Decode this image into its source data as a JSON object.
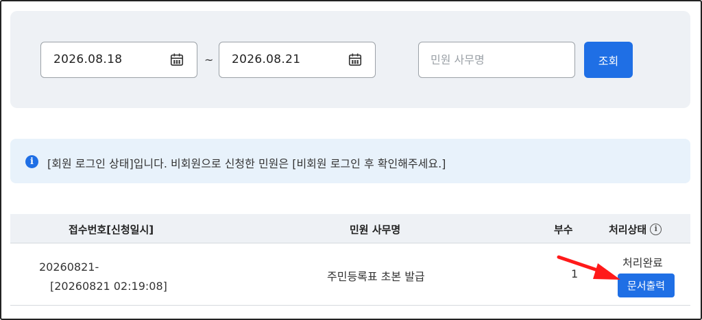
{
  "search": {
    "start_date": "2026.08.18",
    "end_date": "2026.08.21",
    "separator": "~",
    "service_placeholder": "민원 사무명",
    "search_button": "조회",
    "calendar_icon": "calendar-icon"
  },
  "notice": {
    "icon": "info-icon",
    "text": "[회원 로그인 상태]입니다. 비회원으로 신청한 민원은 [비회원 로그인 후 확인해주세요.]"
  },
  "table": {
    "headers": {
      "receipt": "접수번호[신청일시]",
      "service": "민원 사무명",
      "copies": "부수",
      "status": "처리상태"
    },
    "rows": [
      {
        "receipt_no": "20260821-",
        "applied_at": "[20260821 02:19:08]",
        "service": "주민등록표 초본 발급",
        "copies": "1",
        "status": "처리완료",
        "print_button": "문서출력"
      }
    ]
  },
  "colors": {
    "accent": "#1f6fe5",
    "panel_bg": "#eef1f5",
    "notice_bg": "#e8f2fb",
    "annotation_arrow": "#ff1a1a"
  }
}
